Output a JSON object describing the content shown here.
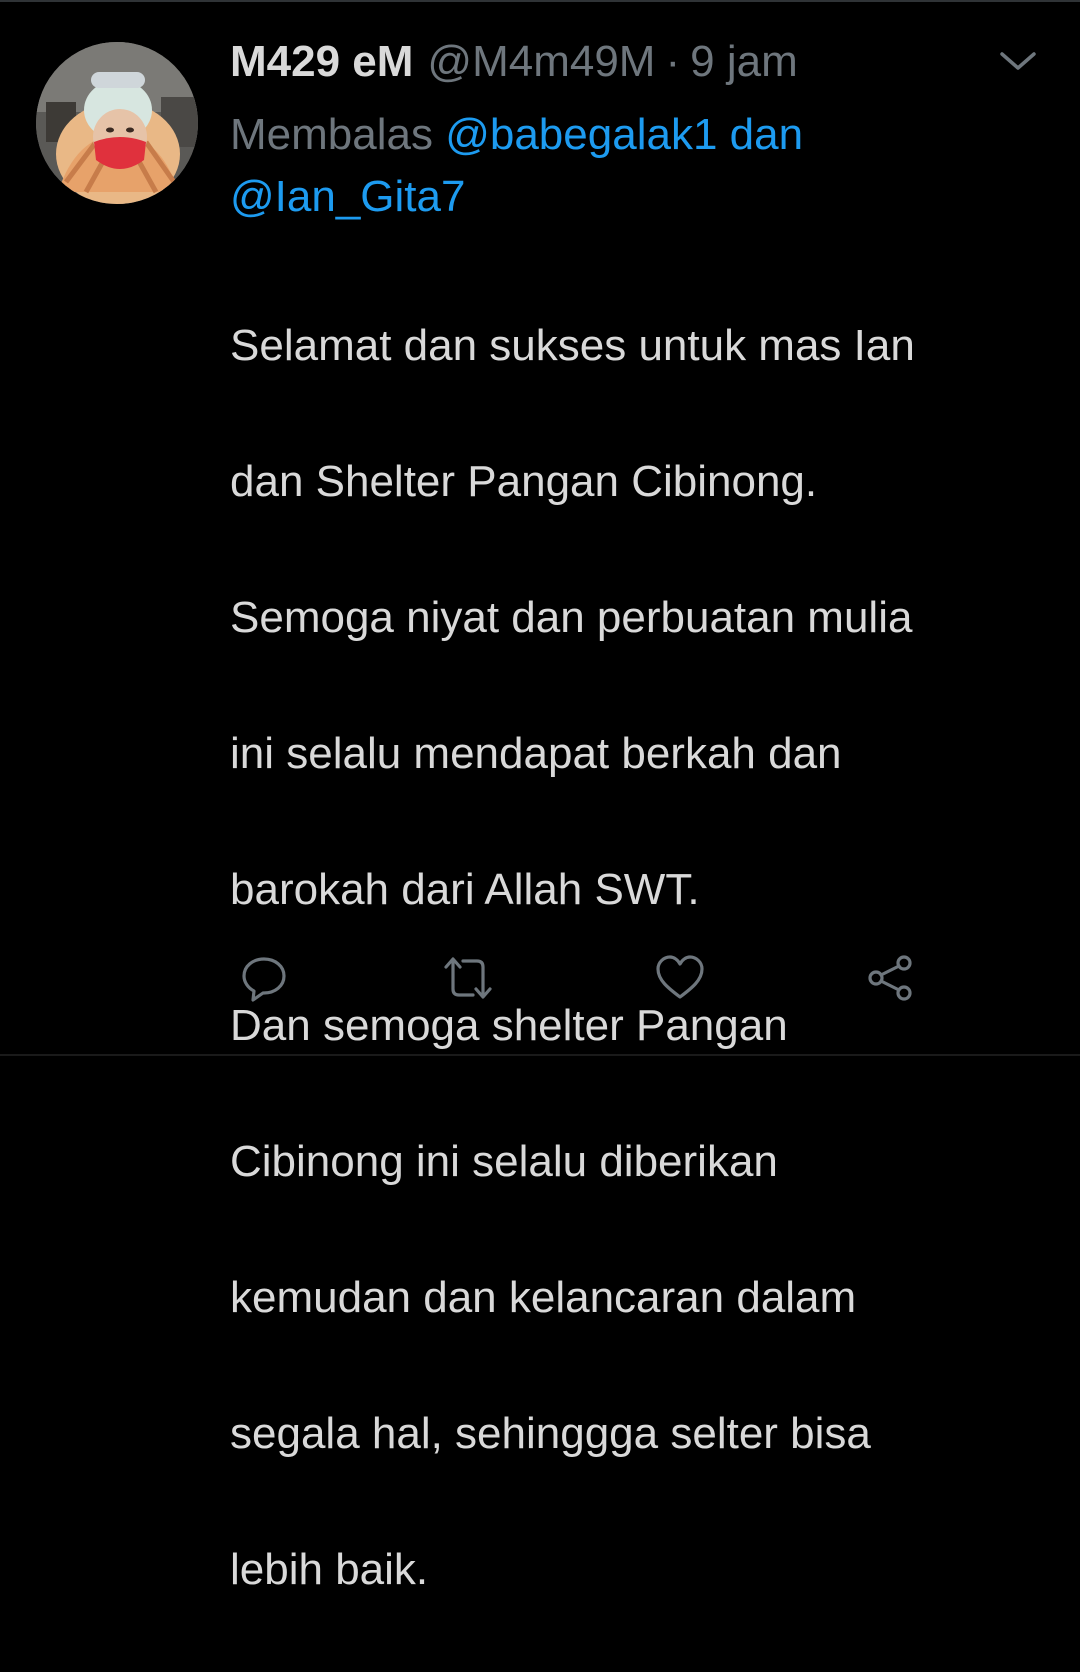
{
  "tweet": {
    "display_name": "M429 eM",
    "handle": "@M4m49M",
    "separator": "·",
    "time": "9 jam",
    "reply_prefix": "Membalas",
    "mention_1": "@babegalak1",
    "mention_joiner": "dan",
    "mention_2": "@Ian_Gita7",
    "text_lines": [
      "Selamat dan sukses untuk mas Ian",
      "dan Shelter Pangan Cibinong.",
      "Semoga niyat dan perbuatan mulia",
      "ini selalu mendapat berkah dan",
      "barokah dari Allah SWT.",
      "Dan semoga shelter Pangan",
      "Cibinong ini selalu diberikan",
      "kemudan dan kelancaran dalam",
      "segala hal, sehinggga selter bisa",
      "lebih baik."
    ]
  },
  "icons": {
    "more": "chevron-down-icon",
    "reply": "reply-icon",
    "retweet": "retweet-icon",
    "like": "heart-icon",
    "share": "share-icon",
    "avatar": "profile-photo"
  },
  "colors": {
    "background": "#000000",
    "text": "#d9d9d9",
    "muted": "#6e767d",
    "mention": "#1d9bf0"
  }
}
